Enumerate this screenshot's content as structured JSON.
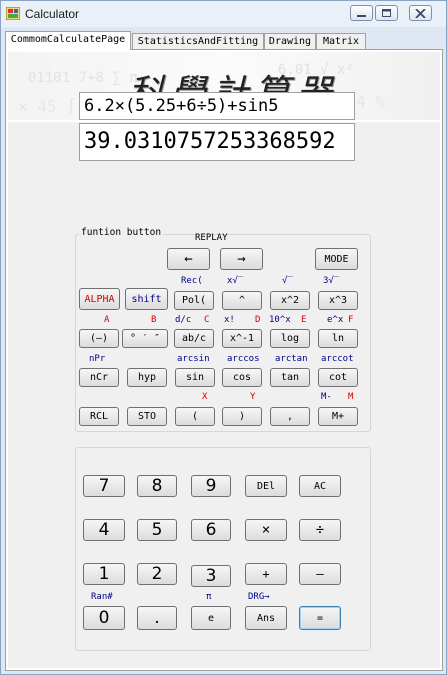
{
  "window": {
    "title": "Calculator"
  },
  "tabs": [
    "CommomCalculatePage",
    "StatisticsAndFitting",
    "Drawing",
    "Matrix"
  ],
  "banner": {
    "title": "科學計算器"
  },
  "display": {
    "expression": "6.2×(5.25+6÷5)+sin5",
    "result": "39.0310757253368592"
  },
  "function_group": {
    "label": "funtion button",
    "replay": "REPLAY",
    "left_arrow": "←",
    "right_arrow": "→",
    "mode": "MODE",
    "alpha": "ALPHA",
    "shift": "shift",
    "pol": "Pol(",
    "caret": "^",
    "x2": "x^2",
    "x3": "x^3",
    "neg": "(–)",
    "dms": "° ′ ″",
    "abc": "ab/c",
    "inv": "x^-1",
    "log": "log",
    "ln": "ln",
    "ncr": "nCr",
    "hyp": "hyp",
    "sin": "sin",
    "cos": "cos",
    "tan": "tan",
    "cot": "cot",
    "rcl": "RCL",
    "sto": "STO",
    "lparen": "(",
    "rparen": ")",
    "comma": ",",
    "mplus": "M+",
    "labels": {
      "rec": "Rec(",
      "xroot": "x√‾",
      "sqrt": "√‾",
      "cbrt": "3√‾",
      "a": "A",
      "b": "B",
      "dc": "d/c",
      "c": "C",
      "fact": "x!",
      "d": "D",
      "tenx": "10^x",
      "e": "E",
      "ex": "e^x",
      "f": "F",
      "npr": "nPr",
      "arcsin": "arcsin",
      "arccos": "arccos",
      "arctan": "arctan",
      "arccot": "arccot",
      "x": "X",
      "y": "Y",
      "mminus": "M-",
      "m": "M"
    }
  },
  "keypad": {
    "k7": "7",
    "k8": "8",
    "k9": "9",
    "del": "DEl",
    "ac": "AC",
    "k4": "4",
    "k5": "5",
    "k6": "6",
    "mul": "×",
    "div": "÷",
    "k1": "1",
    "k2": "2",
    "k3": "3",
    "add": "+",
    "sub": "–",
    "k0": "0",
    "dot": ".",
    "e": "e",
    "ans": "Ans",
    "equals": "=",
    "labels": {
      "ran": "Ran#",
      "pi": "π",
      "drg": "DRG→"
    }
  }
}
